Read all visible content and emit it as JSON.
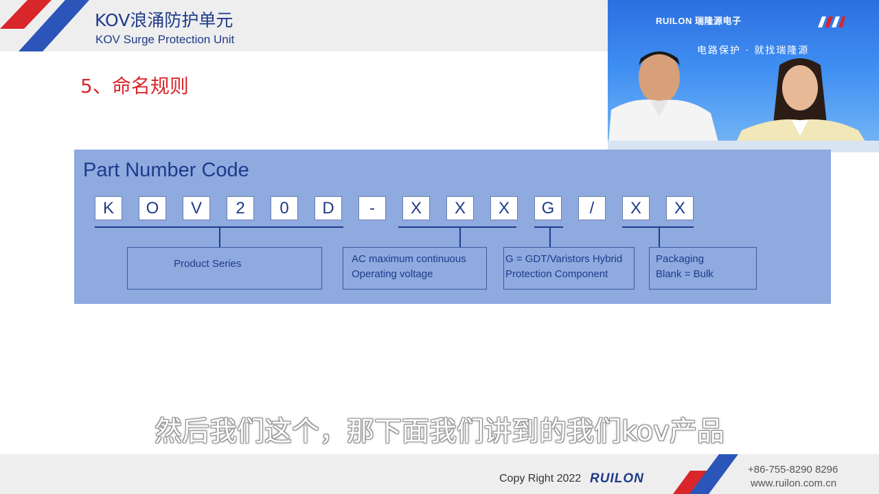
{
  "header": {
    "title_cn": "KOV浪涌防护单元",
    "title_en": "KOV Surge Protection Unit"
  },
  "video": {
    "brand": "RUILON 瑞隆源电子",
    "slogan": "电路保护 · 就找瑞隆源"
  },
  "section": {
    "title": "5、命名规则"
  },
  "part_number": {
    "title": "Part Number Code",
    "code_chars": [
      "K",
      "O",
      "V",
      "2",
      "0",
      "D",
      "-",
      "X",
      "X",
      "X",
      "G",
      "/",
      "X",
      "X"
    ],
    "descriptions": [
      {
        "line1": "Product Series",
        "line2": ""
      },
      {
        "line1": "AC maximum continuous",
        "line2": "Operating voltage"
      },
      {
        "line1": "G = GDT/Varistors Hybrid",
        "line2": "Protection Component"
      },
      {
        "line1": "Packaging",
        "line2": "Blank = Bulk"
      }
    ]
  },
  "subtitle": "然后我们这个，那下面我们讲到的我们kov产品",
  "footer": {
    "copyright": "Copy Right 2022",
    "logo": "RUILON",
    "phone": "+86-755-8290 8296",
    "website": "www.ruilon.com.cn"
  },
  "colors": {
    "brand_blue": "#1f3a8a",
    "accent_red": "#d9262b",
    "panel_blue": "#8eaadf"
  }
}
